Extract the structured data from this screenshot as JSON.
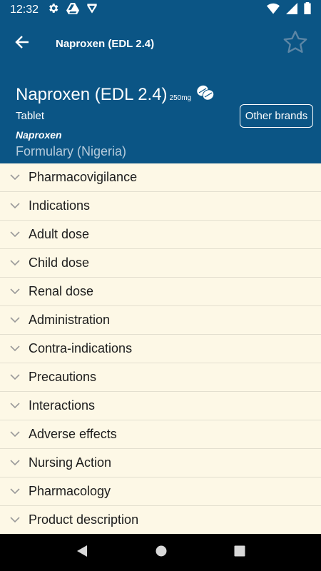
{
  "status": {
    "time": "12:32",
    "left_icons": [
      "gear-icon",
      "drive-icon",
      "check-icon"
    ],
    "right_icons": [
      "wifi-icon",
      "signal-icon",
      "battery-icon"
    ]
  },
  "app_bar": {
    "title": "Naproxen (EDL 2.4)",
    "back_icon": "arrow-left-icon",
    "favorite_icon": "star-outline-icon"
  },
  "drug": {
    "name": "Naproxen (EDL 2.4)",
    "strength": "250mg",
    "form": "Tablet",
    "generic": "Naproxen",
    "source": "Formulary (Nigeria)",
    "other_brands_label": "Other brands"
  },
  "sections": [
    {
      "label": "Pharmacovigilance"
    },
    {
      "label": "Indications"
    },
    {
      "label": "Adult dose"
    },
    {
      "label": "Child dose"
    },
    {
      "label": "Renal dose"
    },
    {
      "label": "Administration"
    },
    {
      "label": "Contra-indications"
    },
    {
      "label": "Precautions"
    },
    {
      "label": "Interactions"
    },
    {
      "label": "Adverse effects"
    },
    {
      "label": "Nursing Action"
    },
    {
      "label": "Pharmacology"
    },
    {
      "label": "Product description"
    }
  ],
  "nav": [
    "back-triangle-icon",
    "home-circle-icon",
    "recents-square-icon"
  ],
  "colors": {
    "header": "#0b5585",
    "content_bg": "#fdf8e6",
    "divider": "#e3dfcf"
  }
}
